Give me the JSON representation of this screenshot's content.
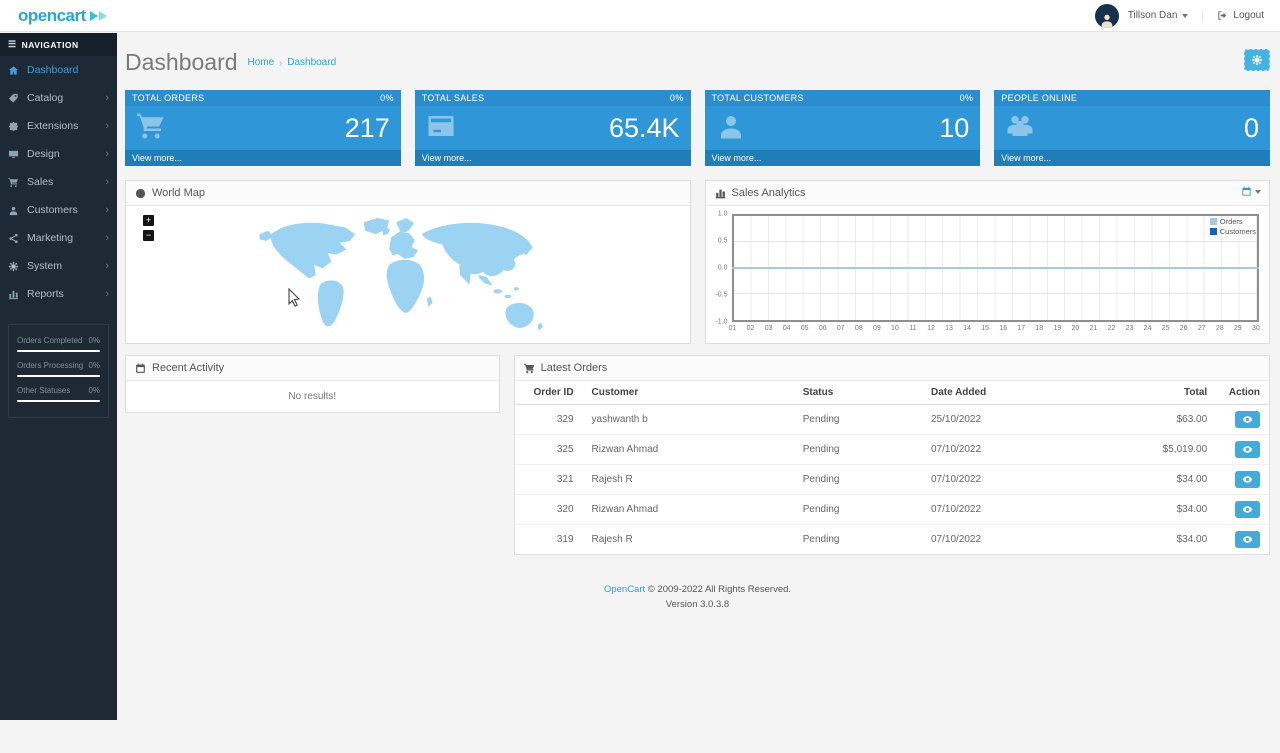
{
  "header": {
    "logo_text": "opencart",
    "user_name": "Tillson Dan",
    "logout_label": "Logout"
  },
  "sidebar": {
    "nav_label": "NAVIGATION",
    "items": [
      {
        "label": "Dashboard",
        "icon": "dashboard-icon",
        "active": true,
        "has_children": false
      },
      {
        "label": "Catalog",
        "icon": "catalog-icon",
        "active": false,
        "has_children": true
      },
      {
        "label": "Extensions",
        "icon": "extensions-icon",
        "active": false,
        "has_children": true
      },
      {
        "label": "Design",
        "icon": "design-icon",
        "active": false,
        "has_children": true
      },
      {
        "label": "Sales",
        "icon": "sales-icon",
        "active": false,
        "has_children": true
      },
      {
        "label": "Customers",
        "icon": "customers-icon",
        "active": false,
        "has_children": true
      },
      {
        "label": "Marketing",
        "icon": "marketing-icon",
        "active": false,
        "has_children": true
      },
      {
        "label": "System",
        "icon": "system-icon",
        "active": false,
        "has_children": true
      },
      {
        "label": "Reports",
        "icon": "reports-icon",
        "active": false,
        "has_children": true
      }
    ],
    "stats": [
      {
        "label": "Orders Completed",
        "value": "0%"
      },
      {
        "label": "Orders Processing",
        "value": "0%"
      },
      {
        "label": "Other Statuses",
        "value": "0%"
      }
    ]
  },
  "page": {
    "title": "Dashboard",
    "breadcrumb": [
      {
        "label": "Home"
      },
      {
        "label": "Dashboard"
      }
    ]
  },
  "tiles": [
    {
      "heading": "TOTAL ORDERS",
      "percent": "0%",
      "value": "217",
      "icon": "cart-icon",
      "footer": "View more..."
    },
    {
      "heading": "TOTAL SALES",
      "percent": "0%",
      "value": "65.4K",
      "icon": "credit-card-icon",
      "footer": "View more..."
    },
    {
      "heading": "TOTAL CUSTOMERS",
      "percent": "0%",
      "value": "10",
      "icon": "user-icon",
      "footer": "View more..."
    },
    {
      "heading": "PEOPLE ONLINE",
      "percent": "",
      "value": "0",
      "icon": "users-icon",
      "footer": "View more..."
    }
  ],
  "world_map": {
    "title": "World Map",
    "zoom_in": "+",
    "zoom_out": "−"
  },
  "sales_analytics": {
    "title": "Sales Analytics"
  },
  "chart_data": {
    "type": "line",
    "title": "Sales Analytics",
    "x": [
      "01",
      "02",
      "03",
      "04",
      "05",
      "06",
      "07",
      "08",
      "09",
      "10",
      "11",
      "12",
      "13",
      "14",
      "15",
      "16",
      "17",
      "18",
      "19",
      "20",
      "21",
      "22",
      "23",
      "24",
      "25",
      "26",
      "27",
      "28",
      "29",
      "30"
    ],
    "xlabel": "",
    "ylabel": "",
    "ylim": [
      -1.0,
      1.0
    ],
    "y_ticks": [
      "1.0",
      "0.5",
      "0.0",
      "-0.5",
      "-1.0"
    ],
    "grid": true,
    "legend_position": "top-right",
    "series": [
      {
        "name": "Orders",
        "color": "#a9c6e2",
        "values": [
          0,
          0,
          0,
          0,
          0,
          0,
          0,
          0,
          0,
          0,
          0,
          0,
          0,
          0,
          0,
          0,
          0,
          0,
          0,
          0,
          0,
          0,
          0,
          0,
          0,
          0,
          0,
          0,
          0,
          0
        ]
      },
      {
        "name": "Customers",
        "color": "#1563b8",
        "values": [
          0,
          0,
          0,
          0,
          0,
          0,
          0,
          0,
          0,
          0,
          0,
          0,
          0,
          0,
          0,
          0,
          0,
          0,
          0,
          0,
          0,
          0,
          0,
          0,
          0,
          0,
          0,
          0,
          0,
          0
        ]
      }
    ]
  },
  "recent_activity": {
    "title": "Recent Activity",
    "empty_message": "No results!"
  },
  "latest_orders": {
    "title": "Latest Orders",
    "columns": [
      "Order ID",
      "Customer",
      "Status",
      "Date Added",
      "Total",
      "Action"
    ],
    "rows": [
      {
        "order_id": "329",
        "customer": "yashwanth b",
        "status": "Pending",
        "date_added": "25/10/2022",
        "total": "$63.00"
      },
      {
        "order_id": "325",
        "customer": "Rizwan Ahmad",
        "status": "Pending",
        "date_added": "07/10/2022",
        "total": "$5,019.00"
      },
      {
        "order_id": "321",
        "customer": "Rajesh R",
        "status": "Pending",
        "date_added": "07/10/2022",
        "total": "$34.00"
      },
      {
        "order_id": "320",
        "customer": "Rizwan Ahmad",
        "status": "Pending",
        "date_added": "07/10/2022",
        "total": "$34.00"
      },
      {
        "order_id": "319",
        "customer": "Rajesh R",
        "status": "Pending",
        "date_added": "07/10/2022",
        "total": "$34.00"
      }
    ]
  },
  "footer": {
    "link": "OpenCart",
    "text": "© 2009-2022 All Rights Reserved.",
    "version": "Version 3.0.3.8"
  },
  "colors": {
    "accent": "#2f96d8",
    "tile_header": "#2b8dcd",
    "tile_footer": "#1f7db9",
    "sidebar_bg": "#1d2a35",
    "map_fill": "#9cd3f2",
    "link": "#28a2dc",
    "orders_series": "#a9c6e2",
    "customers_series": "#1563b8",
    "button_blue": "#42abd9"
  }
}
